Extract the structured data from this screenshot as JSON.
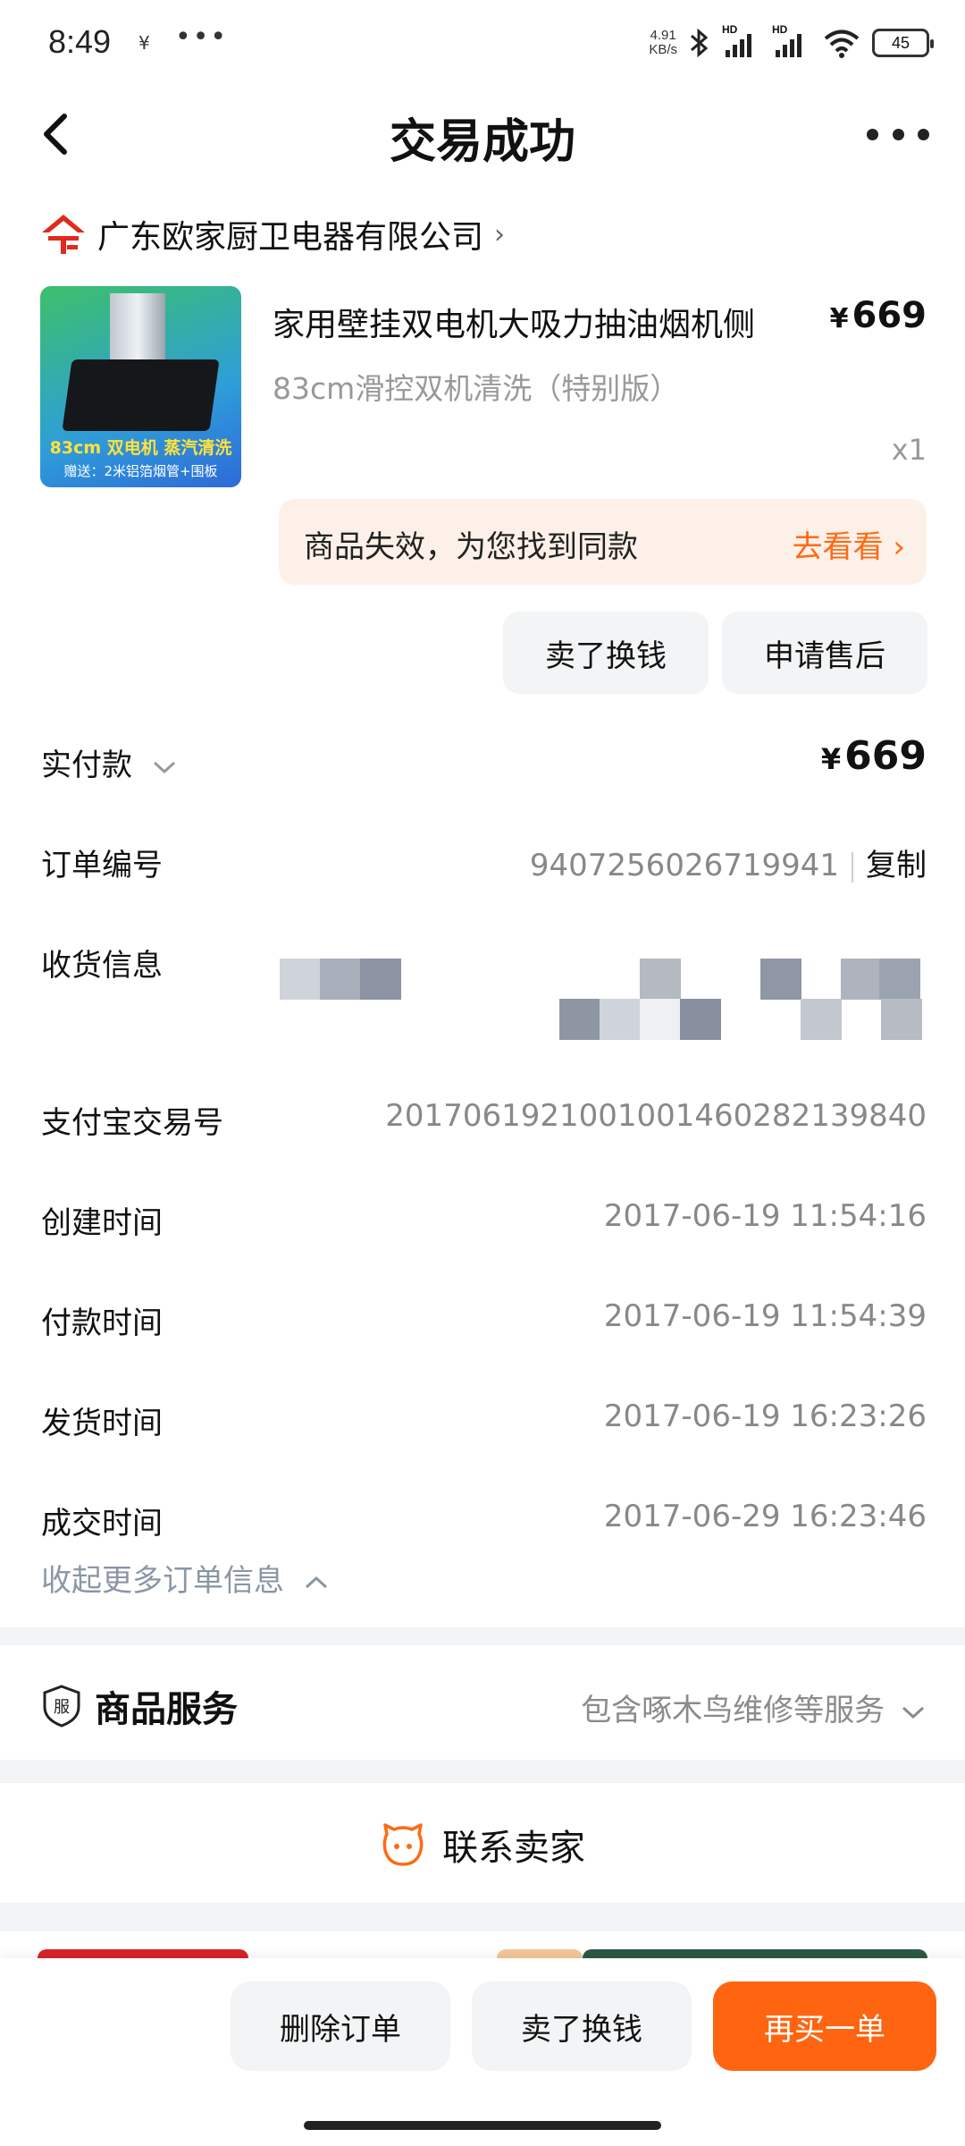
{
  "status_bar": {
    "time": "8:49",
    "notif_glyph": "¥",
    "dots": "•••",
    "net_speed_value": "4.91",
    "net_speed_unit": "KB/s",
    "hd1": "HD",
    "hd2": "HD",
    "battery": "45"
  },
  "header": {
    "title": "交易成功"
  },
  "store": {
    "name": "广东欧家厨卫电器有限公司"
  },
  "product": {
    "title": "家用壁挂双电机大吸力抽油烟机侧",
    "price_symbol": "¥",
    "price": "669",
    "spec": "83cm滑控双机清洗（特别版）",
    "qty": "x1",
    "image_caption_main": "83cm  双电机  蒸汽清洗",
    "image_caption_sub": "赠送：2米铝箔烟管+围板"
  },
  "notice": {
    "text": "商品失效，为您找到同款",
    "link": "去看看 ›"
  },
  "item_actions": {
    "sell": "卖了换钱",
    "after_sale": "申请售后"
  },
  "order_info": {
    "paid_label": "实付款",
    "paid_symbol": "¥",
    "paid_amount": "669",
    "order_no_label": "订单编号",
    "order_no": "9407256026719941",
    "copy": "复制",
    "shipping_label": "收货信息",
    "alipay_label": "支付宝交易号",
    "alipay_no": "2017061921001001460282139840",
    "created_label": "创建时间",
    "created": "2017-06-19 11:54:16",
    "paid_time_label": "付款时间",
    "paid_time": "2017-06-19 11:54:39",
    "shipped_label": "发货时间",
    "shipped": "2017-06-19 16:23:26",
    "completed_label": "成交时间",
    "completed": "2017-06-29 16:23:46",
    "collapse": "收起更多订单信息"
  },
  "service": {
    "icon_text": "服",
    "title": "商品服务",
    "desc": "包含啄木鸟维修等服务"
  },
  "contact": {
    "label": "联系卖家"
  },
  "bottom_bar": {
    "delete": "删除订单",
    "sell": "卖了换钱",
    "rebuy": "再买一单"
  },
  "colors": {
    "accent": "#ff6510",
    "link": "#ff6a14",
    "notice_bg": "#fdf0e8",
    "muted": "#8b96a6"
  }
}
